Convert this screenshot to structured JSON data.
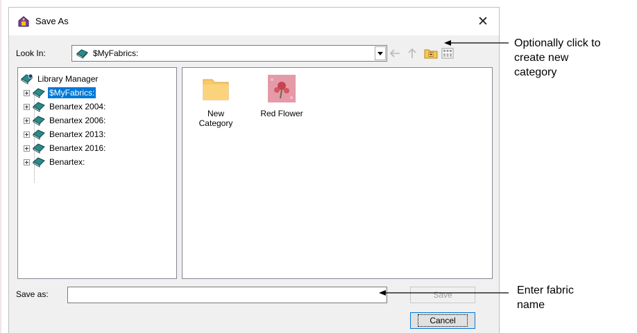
{
  "dialog": {
    "title": "Save As",
    "close_glyph": "✕",
    "look_in_label": "Look In:",
    "look_in_value": "$MyFabrics:",
    "save_as_label": "Save as:",
    "save_as_value": "",
    "save_button": "Save",
    "cancel_button": "Cancel",
    "toolbar_icons": [
      "back-arrow-icon",
      "up-folder-icon",
      "new-folder-icon",
      "view-menu-icon"
    ]
  },
  "tree": {
    "root": "Library Manager",
    "items": [
      {
        "label": "$MyFabrics:",
        "selected": true
      },
      {
        "label": "Benartex 2004:",
        "selected": false
      },
      {
        "label": "Benartex 2006:",
        "selected": false
      },
      {
        "label": "Benartex 2013:",
        "selected": false
      },
      {
        "label": "Benartex 2016:",
        "selected": false
      },
      {
        "label": "Benartex:",
        "selected": false
      }
    ]
  },
  "files": [
    {
      "line1": "New",
      "line2": "Category",
      "icon": "folder-icon"
    },
    {
      "line1": "Red Flower",
      "line2": "",
      "icon": "fabric-thumbnail-icon"
    }
  ],
  "callouts": {
    "top": [
      "Optionally click to",
      "create new",
      "category"
    ],
    "bottom": [
      "Enter fabric",
      "name"
    ]
  },
  "colors": {
    "selection": "#0078d7",
    "book": "#2b8a8a",
    "folder": "#f8c86a",
    "fabric": "#e59aa8"
  }
}
